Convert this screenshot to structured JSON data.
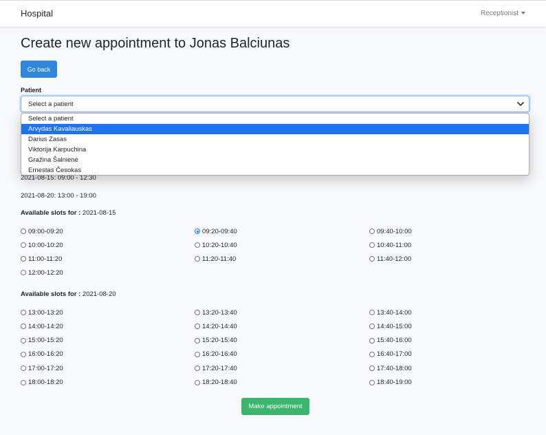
{
  "navbar": {
    "brand": "Hospital",
    "user": "Receptionist"
  },
  "page": {
    "title": "Create new appointment to Jonas Balciunas",
    "back_label": "Go back"
  },
  "patient_field": {
    "label": "Patient",
    "selected": "Select a patient",
    "options": [
      "Select a patient",
      "Arvydas Kavaliauskas",
      "Darius Zasas",
      "Viktorija Karpuchina",
      "Gražina Šalnienė",
      "Ernestas Česokas"
    ],
    "highlighted_index": 1
  },
  "schedule": [
    "2021-08-15: 09:00 - 12:30",
    "2021-08-20: 13:00 - 19:00"
  ],
  "slot_groups": [
    {
      "heading_label": "Available slots for :",
      "date": "2021-08-15",
      "slots": [
        "09:00-09:20",
        "09:20-09:40",
        "09:40-10:00",
        "10:00-10:20",
        "10:20-10:40",
        "10:40-11:00",
        "11:00-11:20",
        "11:20-11:40",
        "11:40-12:00",
        "12:00-12:20"
      ],
      "checked_index": 1
    },
    {
      "heading_label": "Available slots for :",
      "date": "2021-08-20",
      "slots": [
        "13:00-13:20",
        "13:20-13:40",
        "13:40-14:00",
        "14:00-14:20",
        "14:20-14:40",
        "14:40-15:00",
        "15:00-15:20",
        "15:20-15:40",
        "15:40-16:00",
        "16:00-16:20",
        "16:20-16:40",
        "16:40-17:00",
        "17:00-17:20",
        "17:20-17:40",
        "17:40-18:00",
        "18:00-18:20",
        "18:20-18:40",
        "18:40-19:00"
      ],
      "checked_index": -1
    }
  ],
  "submit_label": "Make appointment",
  "colors": {
    "primary": "#2f86d6",
    "success": "#3cb56d",
    "option_highlight": "#1e73e8"
  },
  "icons": {
    "select_chevron": "chevron-down-icon",
    "user_caret": "caret-down-icon"
  }
}
